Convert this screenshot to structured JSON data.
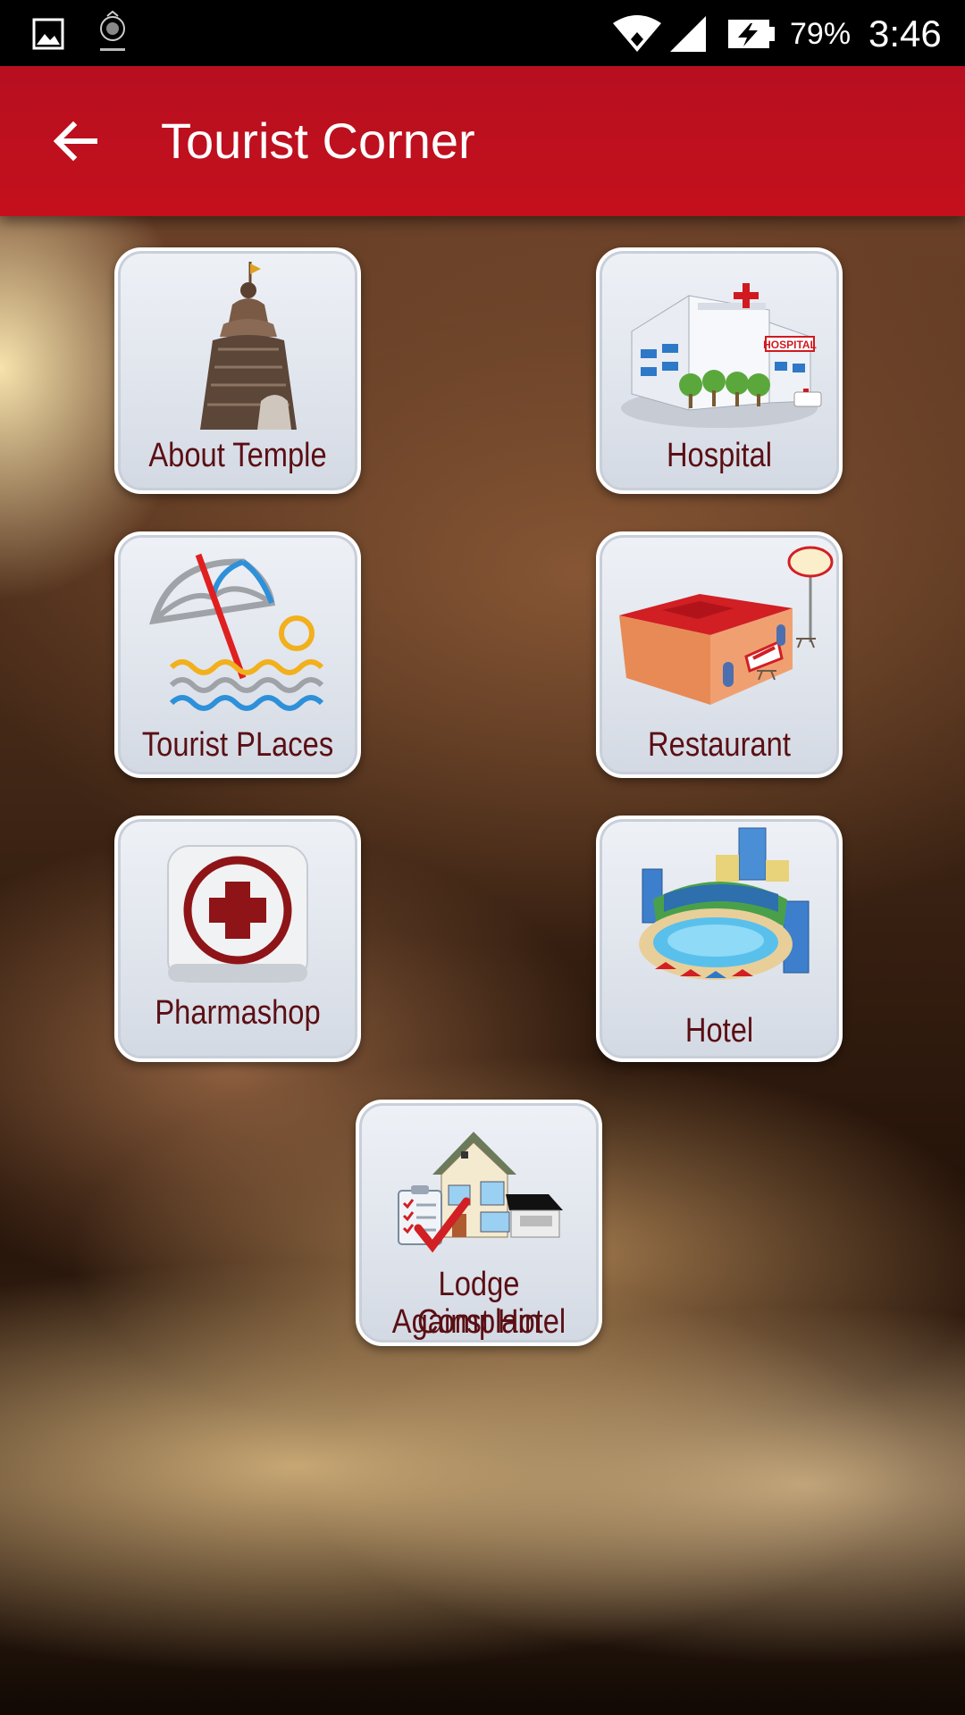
{
  "status_bar": {
    "battery_percent": "79%",
    "time": "3:46",
    "icons": [
      "gallery-icon",
      "police-logo-icon",
      "wifi-icon",
      "signal-icon",
      "battery-icon"
    ]
  },
  "app_bar": {
    "title": "Tourist Corner",
    "back_icon": "arrow-left-icon",
    "color": "#c4101c"
  },
  "tiles": [
    {
      "label": "About Temple",
      "icon": "temple-icon"
    },
    {
      "label": "Hospital",
      "icon": "hospital-icon"
    },
    {
      "label": "Tourist  PLaces",
      "icon": "beach-umbrella-icon"
    },
    {
      "label": "Restaurant",
      "icon": "restaurant-icon"
    },
    {
      "label": "Pharmashop",
      "icon": "medical-cross-icon"
    },
    {
      "label": "Hotel",
      "icon": "hotel-pool-icon"
    },
    {
      "label_line1": "Lodge Complain",
      "label_line2": "Against Hotel",
      "icon": "lodge-complaint-icon"
    }
  ],
  "colors": {
    "tile_label": "#5a0f14",
    "tile_border": "#ffffff"
  }
}
